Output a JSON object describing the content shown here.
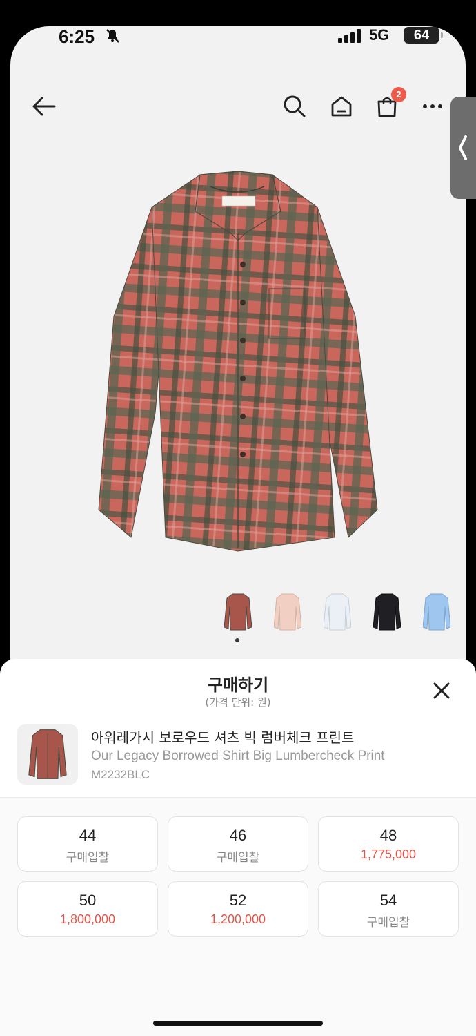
{
  "status": {
    "time": "6:25",
    "network": "5G",
    "battery": "64"
  },
  "nav": {
    "cart_count": "2"
  },
  "sheet": {
    "title": "구매하기",
    "subtitle": "(가격 단위: 원)",
    "product": {
      "name_kr": "아워레가시 보로우드 셔츠 빅 럼버체크 프린트",
      "name_en": "Our Legacy Borrowed Shirt Big Lumbercheck Print",
      "code": "M2232BLC"
    },
    "sizes": [
      {
        "size": "44",
        "price": "구매입찰",
        "has_price": false
      },
      {
        "size": "46",
        "price": "구매입찰",
        "has_price": false
      },
      {
        "size": "48",
        "price": "1,775,000",
        "has_price": true
      },
      {
        "size": "50",
        "price": "1,800,000",
        "has_price": true
      },
      {
        "size": "52",
        "price": "1,200,000",
        "has_price": true
      },
      {
        "size": "54",
        "price": "구매입찰",
        "has_price": false
      }
    ]
  },
  "colors": {
    "accent_red": "#e05547",
    "badge_red": "#ef5a4a"
  },
  "thumbnails": [
    {
      "name": "plaid",
      "color": "#b0544a"
    },
    {
      "name": "pink",
      "color": "#f2d2c6"
    },
    {
      "name": "white",
      "color": "#e8eef4"
    },
    {
      "name": "black",
      "color": "#1e1e22"
    },
    {
      "name": "blue",
      "color": "#9cc4ec"
    }
  ]
}
